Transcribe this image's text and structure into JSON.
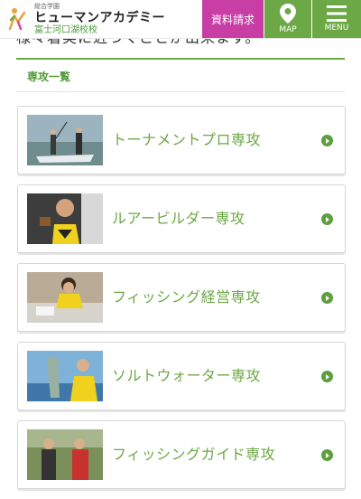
{
  "header": {
    "logo_small": "総合学園",
    "logo_main": "ヒューマンアカデミー",
    "logo_sub": "富士河口湖校校",
    "request_label": "資料請求",
    "map_label": "MAP",
    "menu_label": "MENU"
  },
  "intro_text": "様々着実に近づくことが出来ます。",
  "section_title": "専攻一覧",
  "courses": [
    {
      "label": "トーナメントプロ専攻",
      "photo": "anglers-on-boat"
    },
    {
      "label": "ルアービルダー専攻",
      "photo": "student-holding-lure"
    },
    {
      "label": "フィッシング経営専攻",
      "photo": "student-at-desk"
    },
    {
      "label": "ソルトウォーター専攻",
      "photo": "angler-with-fish"
    },
    {
      "label": "フィッシングガイド専攻",
      "photo": "anglers-outdoors"
    }
  ],
  "colors": {
    "brand_green": "#6ca845",
    "request_magenta": "#c83ea4"
  }
}
